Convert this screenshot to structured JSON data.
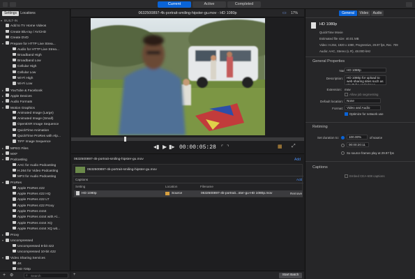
{
  "topbar": {
    "title": "0632500897-4k-portrait-smiling-hipster-gu.mov - HD 1080p",
    "zoom": "17%",
    "segments": {
      "current": "Current",
      "active": "Active",
      "completed": "Completed"
    },
    "inspector_tabs": {
      "general": "General",
      "video": "Video",
      "audio": "Audio"
    }
  },
  "left": {
    "tabs": {
      "settings": "Settings",
      "locations": "Locations"
    },
    "search_placeholder": "Search",
    "tree": [
      {
        "label": "BUILT-IN",
        "level": 0,
        "arrow": "▾",
        "icon": false
      },
      {
        "label": "Add to TV Home Videos",
        "level": 1,
        "icon": true
      },
      {
        "label": "Create Blu-ray / AVCHD",
        "level": 1,
        "icon": true
      },
      {
        "label": "Create DVD",
        "level": 1,
        "icon": true
      },
      {
        "label": "Prepare for HTTP Live Strea...",
        "level": 1,
        "arrow": "▾",
        "icon": true
      },
      {
        "label": "Audio for HTTP Live Strea...",
        "level": 2,
        "icon": true
      },
      {
        "label": "Broadband High",
        "level": 2,
        "icon": true
      },
      {
        "label": "Broadband Low",
        "level": 2,
        "icon": true
      },
      {
        "label": "Cellular High",
        "level": 2,
        "icon": true
      },
      {
        "label": "Cellular Low",
        "level": 2,
        "icon": true
      },
      {
        "label": "Wi-Fi High",
        "level": 2,
        "icon": true
      },
      {
        "label": "Wi-Fi Low",
        "level": 2,
        "icon": true
      },
      {
        "label": "YouTube & Facebook",
        "level": 1,
        "arrow": "▸",
        "icon": true
      },
      {
        "label": "Apple Devices",
        "level": 1,
        "arrow": "▸",
        "icon": true
      },
      {
        "label": "Audio Formats",
        "level": 1,
        "arrow": "▸",
        "icon": true
      },
      {
        "label": "Motion Graphics",
        "level": 1,
        "arrow": "▾",
        "icon": true
      },
      {
        "label": "Animated Image (Large)",
        "level": 2,
        "icon": true
      },
      {
        "label": "Animated Image (Small)",
        "level": 2,
        "icon": true
      },
      {
        "label": "OpenEXR Image Sequence",
        "level": 2,
        "icon": true
      },
      {
        "label": "QuickTime Animation",
        "level": 2,
        "icon": true
      },
      {
        "label": "QuickTime ProRes with Alp...",
        "level": 2,
        "icon": true
      },
      {
        "label": "TIFF Image Sequence",
        "level": 2,
        "icon": true
      },
      {
        "label": "MPEG Files",
        "level": 1,
        "arrow": "▸",
        "icon": true
      },
      {
        "label": "MXF",
        "level": 1,
        "arrow": "▸",
        "icon": true
      },
      {
        "label": "Podcasting",
        "level": 1,
        "arrow": "▾",
        "icon": true
      },
      {
        "label": "AAC for Audio Podcasting",
        "level": 2,
        "icon": true
      },
      {
        "label": "H.264 for Video Podcasting",
        "level": 2,
        "icon": true
      },
      {
        "label": "MP3 for Audio Podcasting",
        "level": 2,
        "icon": true
      },
      {
        "label": "ProRes",
        "level": 1,
        "arrow": "▾",
        "icon": true
      },
      {
        "label": "Apple ProRes 422",
        "level": 2,
        "icon": true
      },
      {
        "label": "Apple ProRes 422 HQ",
        "level": 2,
        "icon": true
      },
      {
        "label": "Apple ProRes 422 LT",
        "level": 2,
        "icon": true
      },
      {
        "label": "Apple ProRes 422 Proxy",
        "level": 2,
        "icon": true
      },
      {
        "label": "Apple ProRes 4444",
        "level": 2,
        "icon": true
      },
      {
        "label": "Apple ProRes 4444 with Al...",
        "level": 2,
        "icon": true
      },
      {
        "label": "Apple ProRes 4444 XQ",
        "level": 2,
        "icon": true
      },
      {
        "label": "Apple ProRes 4444 XQ wit...",
        "level": 2,
        "icon": true
      },
      {
        "label": "Proxy",
        "level": 1,
        "arrow": "▸",
        "icon": true
      },
      {
        "label": "Uncompressed",
        "level": 1,
        "arrow": "▾",
        "icon": true
      },
      {
        "label": "Uncompressed 8-bit 422",
        "level": 2,
        "icon": true
      },
      {
        "label": "Uncompressed 10-bit 422",
        "level": 2,
        "icon": true
      },
      {
        "label": "Video Sharing Services",
        "level": 1,
        "arrow": "▾",
        "icon": true
      },
      {
        "label": "4K",
        "level": 2,
        "icon": true
      },
      {
        "label": "HD 720p",
        "level": 2,
        "icon": true
      },
      {
        "label": "HD 1080p",
        "level": 2,
        "icon": true
      }
    ]
  },
  "player": {
    "timecode": "00:00:05:28"
  },
  "batch": {
    "header_file": "0632500897-4k-portrait-smiling-hipster-gu.mov",
    "add_label": "Add",
    "job_file": "0632500897-4k-portrait-smiling-hipster-gu.mov",
    "captions_label": "Captions",
    "captions_add": "Add",
    "columns": {
      "setting": "Setting",
      "location": "Location",
      "filename": "Filename"
    },
    "job": {
      "setting": "HD 1080p",
      "location": "Source",
      "filename": "0632500897-4k-portrait...ster-gu-HD 1080p.mov",
      "action": "Remove"
    },
    "start_button": "Start Batch"
  },
  "inspector": {
    "summary": {
      "name": "HD 1080p",
      "type": "QuickTime Movie",
      "size": "Estimated file size: 40.01 MB",
      "video": "Video: H.264, 1920 x 1080, Progressive, 29.97 fps, Rec. 709",
      "audio": "Audio: AAC, Stereo (L R), 48.000 kHz"
    },
    "general_title": "General Properties",
    "name_label": "Name:",
    "name_value": "HD 1080p",
    "desc_label": "Description:",
    "desc_value": "HD 1080p for upload to web sharing sites such as YouTube and Vimeo.",
    "ext_label": "Extension:",
    "ext_value": "mov",
    "allow_label": "Allow job segmenting",
    "default_loc_label": "Default location:",
    "default_loc_value": "None",
    "format_label": "Format:",
    "format_value": "Video and Audio",
    "optimize_label": "Optimize for network use",
    "retiming_title": "Retiming",
    "set_duration_label": "Set duration to:",
    "duration_percent": "100.00%",
    "of_source": "of source",
    "duration_tc": "00:00:20:11",
    "so_source": "So source frames play at 29.97 fps",
    "captions_title": "Captions",
    "embed_label": "Embed CEA-608 captions"
  }
}
